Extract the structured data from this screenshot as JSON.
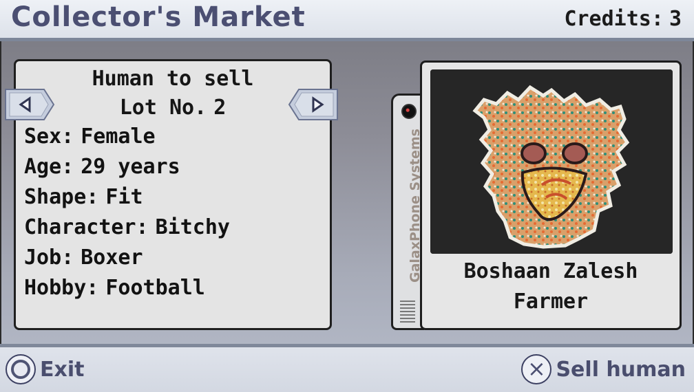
{
  "header": {
    "title": "Collector's Market",
    "credits_label": "Credits:",
    "credits_value": "3"
  },
  "seller_panel": {
    "heading": "Human to sell",
    "lot_label": "Lot No.",
    "lot_number": "2",
    "attributes": [
      {
        "label": "Sex:",
        "value": "Female"
      },
      {
        "label": "Age:",
        "value": "29 years"
      },
      {
        "label": "Shape:",
        "value": "Fit"
      },
      {
        "label": "Character:",
        "value": "Bitchy"
      },
      {
        "label": "Job:",
        "value": "Boxer"
      },
      {
        "label": "Hobby:",
        "value": "Football"
      }
    ],
    "prev_icon": "left-arrow-icon",
    "next_icon": "right-arrow-icon"
  },
  "buyer_card": {
    "vertical_brand": "GalaxPhone Systems",
    "name": "Boshaan Zalesh",
    "occupation": "Farmer"
  },
  "footer": {
    "exit_label": "Exit",
    "sell_label": "Sell human",
    "exit_icon": "circle-button-icon",
    "sell_icon": "cross-button-icon"
  },
  "colors": {
    "header_text": "#4b4f72",
    "panel_border": "#1e1e1e",
    "panel_bg": "#e4e4e4",
    "button_text": "#4a4e6e"
  }
}
